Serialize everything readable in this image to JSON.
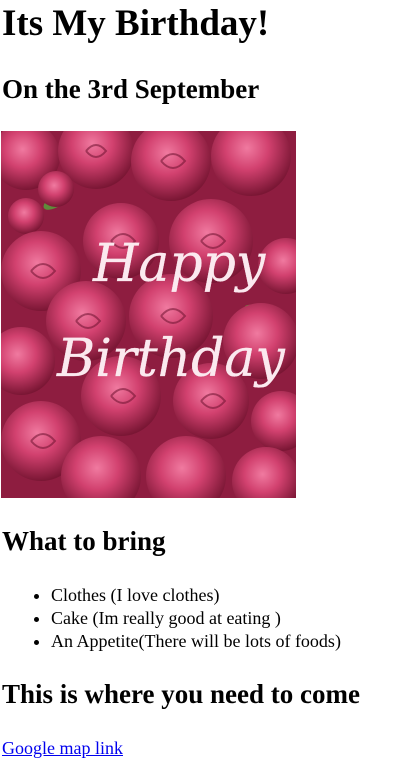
{
  "header": {
    "title": "Its My Birthday!",
    "date": "On the 3rd September"
  },
  "photo": {
    "greeting_line1": "Happy",
    "greeting_line2": "Birthday",
    "colors": {
      "background": "#a8264e",
      "rose_light": "#e25a85",
      "rose_mid": "#c8376a",
      "rose_dark": "#7a1634",
      "leaf": "#5f8b3a",
      "script": "#fbe9ef"
    }
  },
  "bring": {
    "heading": "What to bring",
    "items": [
      "Clothes (I love clothes)",
      "Cake (Im really good at eating )",
      "An Appetite(There will be lots of foods)"
    ]
  },
  "location": {
    "heading": "This is where you need to come",
    "link_text": "Google map link"
  }
}
